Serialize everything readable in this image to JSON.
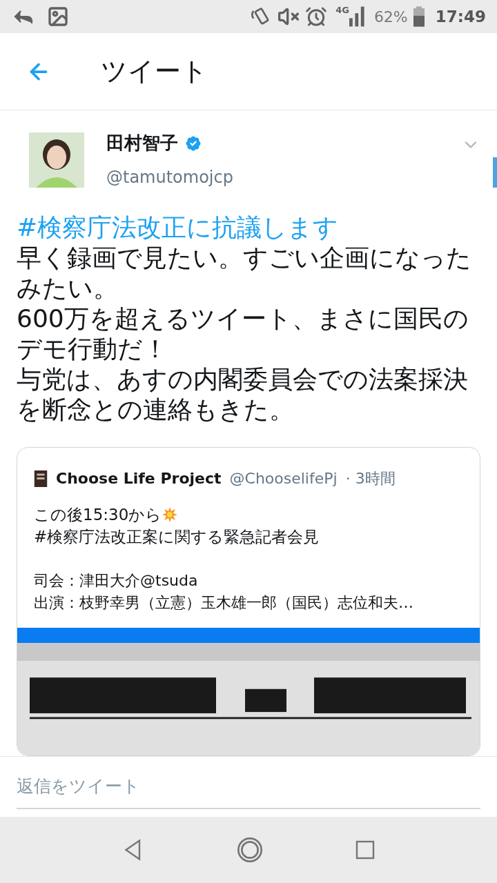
{
  "status_bar": {
    "network": "4G",
    "battery": "62%",
    "time": "17:49"
  },
  "header": {
    "title": "ツイート"
  },
  "tweet": {
    "name": "田村智子",
    "verified": true,
    "handle": "@tamutomojcp",
    "hashtag": "#検察庁法改正に抗議します",
    "body": [
      "早く録画で見たい。すごい企画になったみたい。",
      "600万を超えるツイート、まさに国民のデモ行動だ！",
      "与党は、あすの内閣委員会での法案採決を断念との連絡もきた。"
    ],
    "quote": {
      "name": "Choose Life Project",
      "handle": "@ChooselifePj",
      "time": "· 3時間",
      "line_before": "この後15:30から",
      "line_after": "#検察庁法改正案に関する緊急記者会見",
      "host": "司会：津田大介@tsuda",
      "cast": "出演：枝野幸男（立憲）玉木雄一郎（国民）志位和夫…"
    }
  },
  "reply": {
    "placeholder": "返信をツイート"
  }
}
